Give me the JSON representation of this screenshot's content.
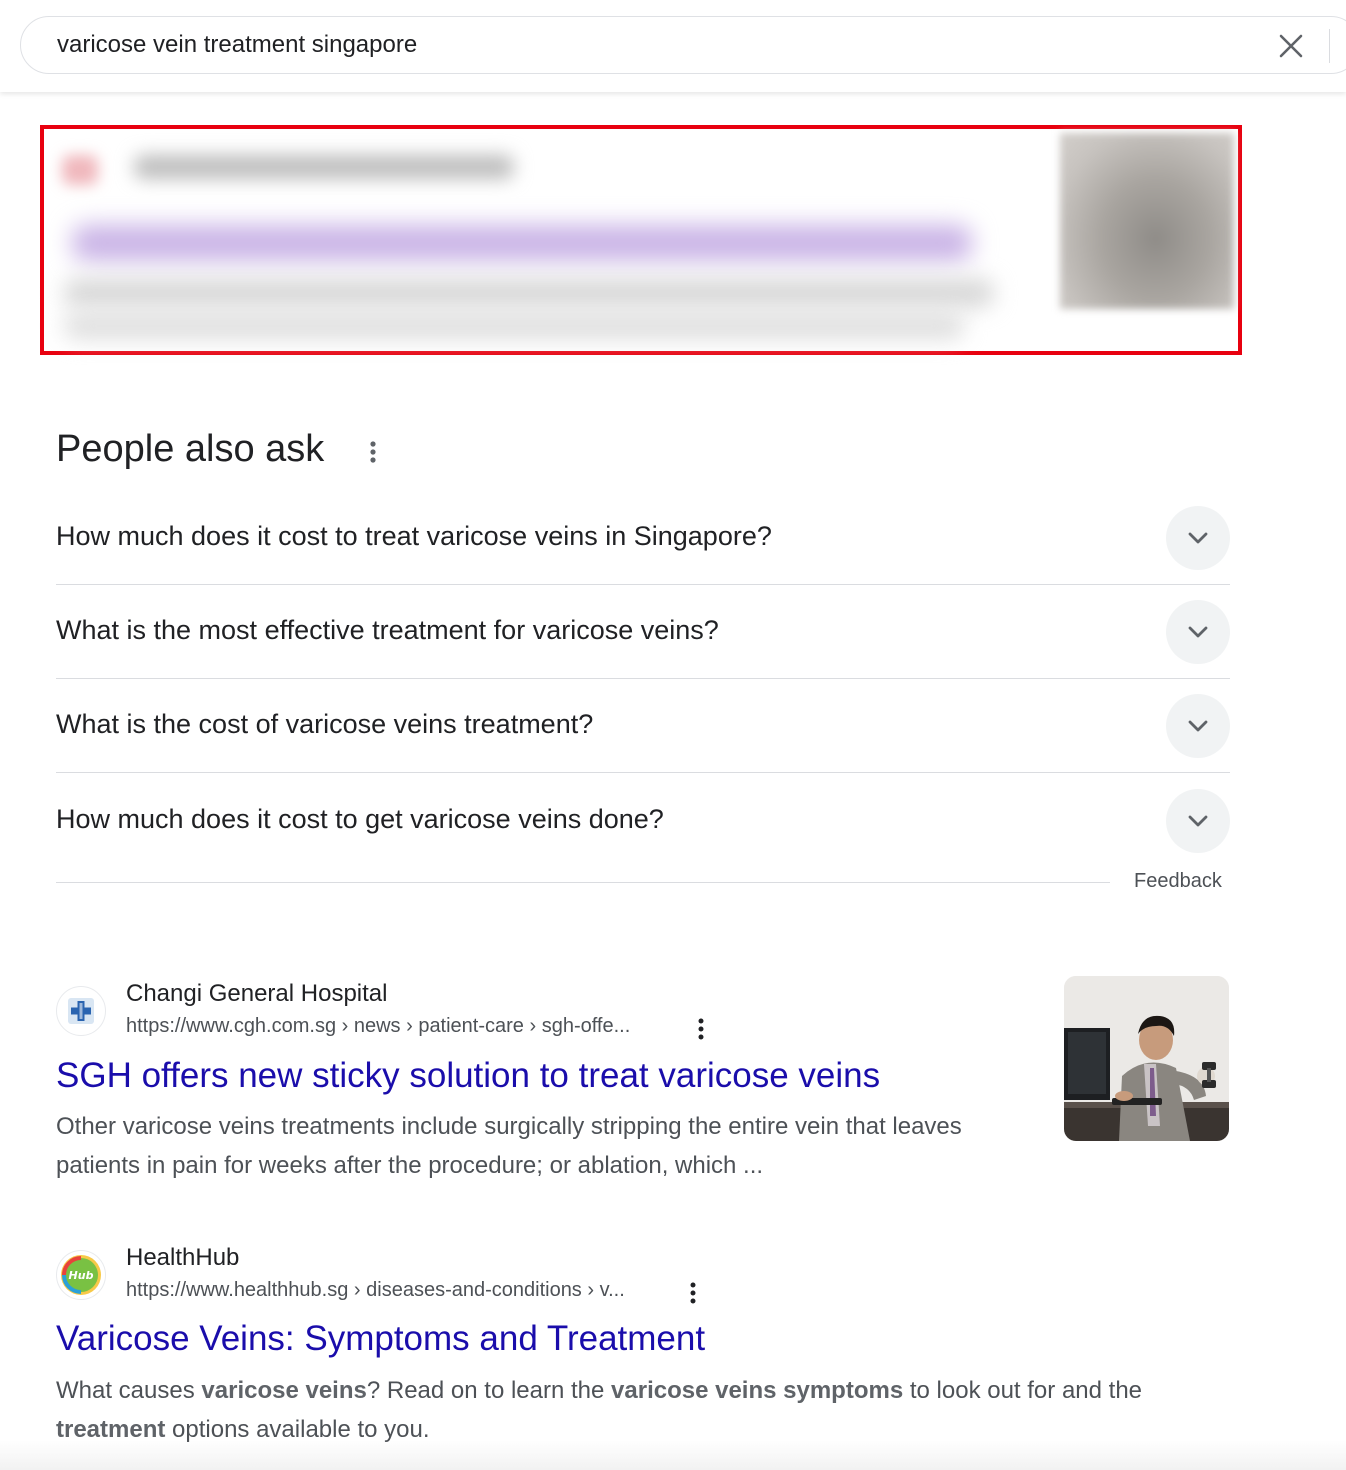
{
  "search": {
    "query": "varicose vein treatment singapore"
  },
  "people_also_ask": {
    "title": "People also ask",
    "questions": [
      "How much does it cost to treat varicose veins in Singapore?",
      "What is the most effective treatment for varicose veins?",
      "What is the cost of varicose veins treatment?",
      "How much does it cost to get varicose veins done?"
    ],
    "feedback": "Feedback"
  },
  "results": [
    {
      "site": "Changi General Hospital",
      "url": "https://www.cgh.com.sg › news › patient-care › sgh-offe...",
      "title": "SGH offers new sticky solution to treat varicose veins",
      "snippet_lines": [
        "Other varicose veins treatments include surgically stripping the entire vein that leaves",
        "patients in pain for weeks after the procedure; or ablation, which ..."
      ]
    },
    {
      "site": "HealthHub",
      "url": "https://www.healthhub.sg › diseases-and-conditions › v...",
      "title": "Varicose Veins: Symptoms and Treatment",
      "favicon_text": "Hub",
      "snippet_parts": [
        "What causes ",
        "varicose veins",
        "? Read on to learn the ",
        "varicose veins symptoms",
        " to look out for and the",
        "treatment",
        " options available to you."
      ]
    }
  ],
  "colors": {
    "link": "#1a0dab",
    "highlight_border": "#e8000f",
    "snippet": "#4d5156"
  }
}
